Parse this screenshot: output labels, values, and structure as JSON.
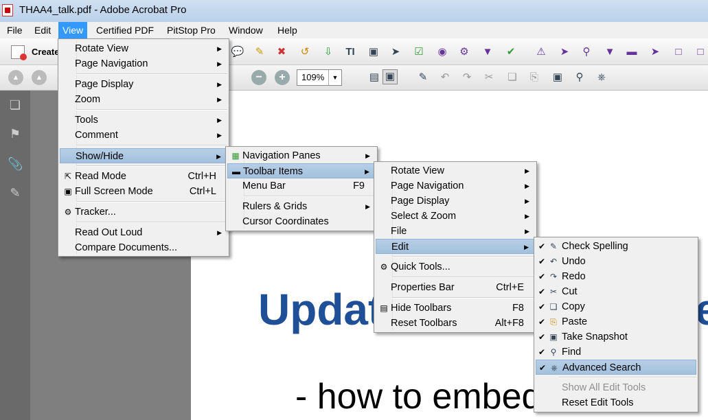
{
  "window": {
    "title": "THAA4_talk.pdf - Adobe Acrobat Pro"
  },
  "menubar": [
    "File",
    "Edit",
    "View",
    "Certified PDF",
    "PitStop Pro",
    "Window",
    "Help"
  ],
  "toolbar": {
    "create_label": "Create",
    "zoom_value": "109%"
  },
  "document": {
    "heading": "Updat",
    "heading_tail": "e",
    "bullet": "- how to embed movies"
  },
  "view_menu": {
    "items": [
      {
        "label": "Rotate View",
        "submenu": true
      },
      {
        "label": "Page Navigation",
        "submenu": true
      },
      {
        "label": "Page Display",
        "submenu": true
      },
      {
        "label": "Zoom",
        "submenu": true
      },
      {
        "label": "Tools",
        "submenu": true
      },
      {
        "label": "Comment",
        "submenu": true
      },
      {
        "label": "Show/Hide",
        "submenu": true
      },
      {
        "label": "Read Mode",
        "shortcut": "Ctrl+H"
      },
      {
        "label": "Full Screen Mode",
        "shortcut": "Ctrl+L"
      },
      {
        "label": "Tracker..."
      },
      {
        "label": "Read Out Loud",
        "submenu": true
      },
      {
        "label": "Compare Documents..."
      }
    ]
  },
  "showhide_menu": {
    "items": [
      {
        "label": "Navigation Panes",
        "submenu": true
      },
      {
        "label": "Toolbar Items",
        "submenu": true
      },
      {
        "label": "Menu Bar",
        "shortcut": "F9"
      },
      {
        "label": "Rulers & Grids",
        "submenu": true
      },
      {
        "label": "Cursor Coordinates"
      }
    ]
  },
  "toolbar_items_menu": {
    "items": [
      {
        "label": "Rotate View",
        "submenu": true
      },
      {
        "label": "Page Navigation",
        "submenu": true
      },
      {
        "label": "Page Display",
        "submenu": true
      },
      {
        "label": "Select & Zoom",
        "submenu": true
      },
      {
        "label": "File",
        "submenu": true
      },
      {
        "label": "Edit",
        "submenu": true
      },
      {
        "label": "Quick Tools..."
      },
      {
        "label": "Properties Bar",
        "shortcut": "Ctrl+E"
      },
      {
        "label": "Hide Toolbars",
        "shortcut": "F8"
      },
      {
        "label": "Reset Toolbars",
        "shortcut": "Alt+F8"
      }
    ]
  },
  "edit_menu": {
    "items": [
      {
        "label": "Check Spelling",
        "checked": true
      },
      {
        "label": "Undo",
        "checked": true
      },
      {
        "label": "Redo",
        "checked": true
      },
      {
        "label": "Cut",
        "checked": true
      },
      {
        "label": "Copy",
        "checked": true
      },
      {
        "label": "Paste",
        "checked": true
      },
      {
        "label": "Take Snapshot",
        "checked": true
      },
      {
        "label": "Find",
        "checked": true
      },
      {
        "label": "Advanced Search",
        "checked": true
      },
      {
        "label": "Show All Edit Tools",
        "disabled": true
      },
      {
        "label": "Reset Edit Tools"
      }
    ]
  },
  "colors": {
    "menu_highlight": "#a3c0dd",
    "menubar_active": "#3399ff",
    "heading": "#1f4f97"
  }
}
